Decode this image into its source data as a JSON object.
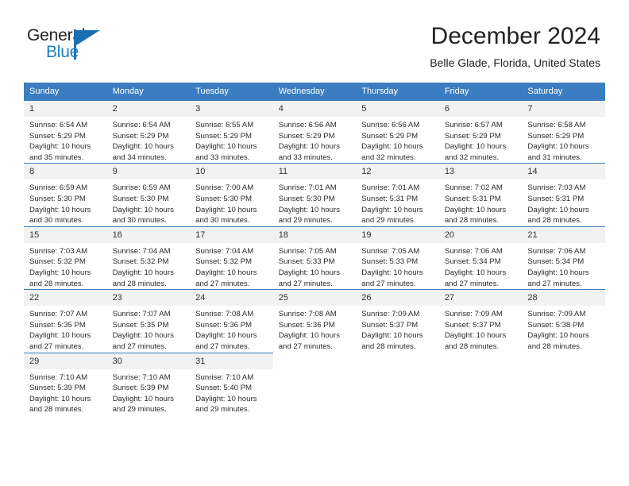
{
  "brand": {
    "name_part1": "General",
    "name_part2": "Blue",
    "accent_color": "#1d6fb4",
    "logo_icon": "triangle-flag-icon"
  },
  "header": {
    "title": "December 2024",
    "subtitle": "Belle Glade, Florida, United States"
  },
  "calendar": {
    "header_bg": "#3a7dc0",
    "daynum_bg": "#f2f2f2",
    "weekdays": [
      "Sunday",
      "Monday",
      "Tuesday",
      "Wednesday",
      "Thursday",
      "Friday",
      "Saturday"
    ],
    "weeks": [
      [
        {
          "day": "1",
          "sunrise": "Sunrise: 6:54 AM",
          "sunset": "Sunset: 5:29 PM",
          "daylight1": "Daylight: 10 hours",
          "daylight2": "and 35 minutes."
        },
        {
          "day": "2",
          "sunrise": "Sunrise: 6:54 AM",
          "sunset": "Sunset: 5:29 PM",
          "daylight1": "Daylight: 10 hours",
          "daylight2": "and 34 minutes."
        },
        {
          "day": "3",
          "sunrise": "Sunrise: 6:55 AM",
          "sunset": "Sunset: 5:29 PM",
          "daylight1": "Daylight: 10 hours",
          "daylight2": "and 33 minutes."
        },
        {
          "day": "4",
          "sunrise": "Sunrise: 6:56 AM",
          "sunset": "Sunset: 5:29 PM",
          "daylight1": "Daylight: 10 hours",
          "daylight2": "and 33 minutes."
        },
        {
          "day": "5",
          "sunrise": "Sunrise: 6:56 AM",
          "sunset": "Sunset: 5:29 PM",
          "daylight1": "Daylight: 10 hours",
          "daylight2": "and 32 minutes."
        },
        {
          "day": "6",
          "sunrise": "Sunrise: 6:57 AM",
          "sunset": "Sunset: 5:29 PM",
          "daylight1": "Daylight: 10 hours",
          "daylight2": "and 32 minutes."
        },
        {
          "day": "7",
          "sunrise": "Sunrise: 6:58 AM",
          "sunset": "Sunset: 5:29 PM",
          "daylight1": "Daylight: 10 hours",
          "daylight2": "and 31 minutes."
        }
      ],
      [
        {
          "day": "8",
          "sunrise": "Sunrise: 6:59 AM",
          "sunset": "Sunset: 5:30 PM",
          "daylight1": "Daylight: 10 hours",
          "daylight2": "and 30 minutes."
        },
        {
          "day": "9",
          "sunrise": "Sunrise: 6:59 AM",
          "sunset": "Sunset: 5:30 PM",
          "daylight1": "Daylight: 10 hours",
          "daylight2": "and 30 minutes."
        },
        {
          "day": "10",
          "sunrise": "Sunrise: 7:00 AM",
          "sunset": "Sunset: 5:30 PM",
          "daylight1": "Daylight: 10 hours",
          "daylight2": "and 30 minutes."
        },
        {
          "day": "11",
          "sunrise": "Sunrise: 7:01 AM",
          "sunset": "Sunset: 5:30 PM",
          "daylight1": "Daylight: 10 hours",
          "daylight2": "and 29 minutes."
        },
        {
          "day": "12",
          "sunrise": "Sunrise: 7:01 AM",
          "sunset": "Sunset: 5:31 PM",
          "daylight1": "Daylight: 10 hours",
          "daylight2": "and 29 minutes."
        },
        {
          "day": "13",
          "sunrise": "Sunrise: 7:02 AM",
          "sunset": "Sunset: 5:31 PM",
          "daylight1": "Daylight: 10 hours",
          "daylight2": "and 28 minutes."
        },
        {
          "day": "14",
          "sunrise": "Sunrise: 7:03 AM",
          "sunset": "Sunset: 5:31 PM",
          "daylight1": "Daylight: 10 hours",
          "daylight2": "and 28 minutes."
        }
      ],
      [
        {
          "day": "15",
          "sunrise": "Sunrise: 7:03 AM",
          "sunset": "Sunset: 5:32 PM",
          "daylight1": "Daylight: 10 hours",
          "daylight2": "and 28 minutes."
        },
        {
          "day": "16",
          "sunrise": "Sunrise: 7:04 AM",
          "sunset": "Sunset: 5:32 PM",
          "daylight1": "Daylight: 10 hours",
          "daylight2": "and 28 minutes."
        },
        {
          "day": "17",
          "sunrise": "Sunrise: 7:04 AM",
          "sunset": "Sunset: 5:32 PM",
          "daylight1": "Daylight: 10 hours",
          "daylight2": "and 27 minutes."
        },
        {
          "day": "18",
          "sunrise": "Sunrise: 7:05 AM",
          "sunset": "Sunset: 5:33 PM",
          "daylight1": "Daylight: 10 hours",
          "daylight2": "and 27 minutes."
        },
        {
          "day": "19",
          "sunrise": "Sunrise: 7:05 AM",
          "sunset": "Sunset: 5:33 PM",
          "daylight1": "Daylight: 10 hours",
          "daylight2": "and 27 minutes."
        },
        {
          "day": "20",
          "sunrise": "Sunrise: 7:06 AM",
          "sunset": "Sunset: 5:34 PM",
          "daylight1": "Daylight: 10 hours",
          "daylight2": "and 27 minutes."
        },
        {
          "day": "21",
          "sunrise": "Sunrise: 7:06 AM",
          "sunset": "Sunset: 5:34 PM",
          "daylight1": "Daylight: 10 hours",
          "daylight2": "and 27 minutes."
        }
      ],
      [
        {
          "day": "22",
          "sunrise": "Sunrise: 7:07 AM",
          "sunset": "Sunset: 5:35 PM",
          "daylight1": "Daylight: 10 hours",
          "daylight2": "and 27 minutes."
        },
        {
          "day": "23",
          "sunrise": "Sunrise: 7:07 AM",
          "sunset": "Sunset: 5:35 PM",
          "daylight1": "Daylight: 10 hours",
          "daylight2": "and 27 minutes."
        },
        {
          "day": "24",
          "sunrise": "Sunrise: 7:08 AM",
          "sunset": "Sunset: 5:36 PM",
          "daylight1": "Daylight: 10 hours",
          "daylight2": "and 27 minutes."
        },
        {
          "day": "25",
          "sunrise": "Sunrise: 7:08 AM",
          "sunset": "Sunset: 5:36 PM",
          "daylight1": "Daylight: 10 hours",
          "daylight2": "and 27 minutes."
        },
        {
          "day": "26",
          "sunrise": "Sunrise: 7:09 AM",
          "sunset": "Sunset: 5:37 PM",
          "daylight1": "Daylight: 10 hours",
          "daylight2": "and 28 minutes."
        },
        {
          "day": "27",
          "sunrise": "Sunrise: 7:09 AM",
          "sunset": "Sunset: 5:37 PM",
          "daylight1": "Daylight: 10 hours",
          "daylight2": "and 28 minutes."
        },
        {
          "day": "28",
          "sunrise": "Sunrise: 7:09 AM",
          "sunset": "Sunset: 5:38 PM",
          "daylight1": "Daylight: 10 hours",
          "daylight2": "and 28 minutes."
        }
      ],
      [
        {
          "day": "29",
          "sunrise": "Sunrise: 7:10 AM",
          "sunset": "Sunset: 5:39 PM",
          "daylight1": "Daylight: 10 hours",
          "daylight2": "and 28 minutes."
        },
        {
          "day": "30",
          "sunrise": "Sunrise: 7:10 AM",
          "sunset": "Sunset: 5:39 PM",
          "daylight1": "Daylight: 10 hours",
          "daylight2": "and 29 minutes."
        },
        {
          "day": "31",
          "sunrise": "Sunrise: 7:10 AM",
          "sunset": "Sunset: 5:40 PM",
          "daylight1": "Daylight: 10 hours",
          "daylight2": "and 29 minutes."
        },
        {
          "day": "",
          "sunrise": "",
          "sunset": "",
          "daylight1": "",
          "daylight2": ""
        },
        {
          "day": "",
          "sunrise": "",
          "sunset": "",
          "daylight1": "",
          "daylight2": ""
        },
        {
          "day": "",
          "sunrise": "",
          "sunset": "",
          "daylight1": "",
          "daylight2": ""
        },
        {
          "day": "",
          "sunrise": "",
          "sunset": "",
          "daylight1": "",
          "daylight2": ""
        }
      ]
    ]
  }
}
